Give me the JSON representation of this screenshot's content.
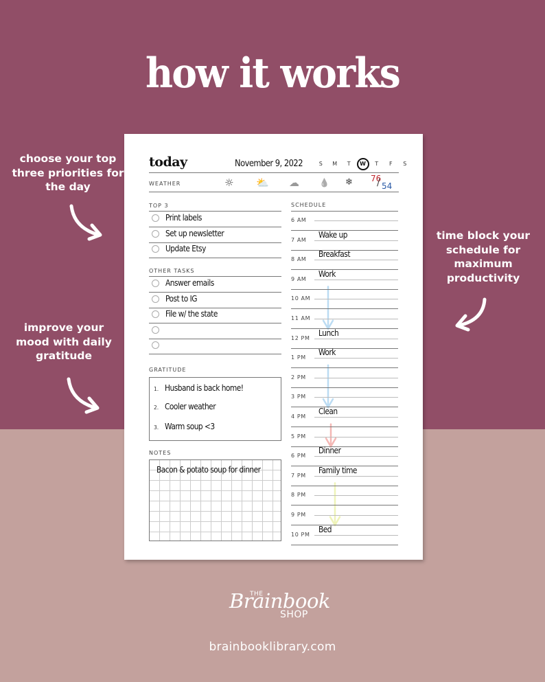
{
  "headline": "how it works",
  "callouts": [
    {
      "id": "priorities",
      "text": "choose your top three priorities for the day"
    },
    {
      "id": "gratitude",
      "text": "improve your mood with daily gratitude"
    },
    {
      "id": "timeblock",
      "text": "time block your schedule for maximum productivity"
    }
  ],
  "planner": {
    "title": "today",
    "date": "November 9, 2022",
    "weekdays": [
      "S",
      "M",
      "T",
      "W",
      "T",
      "F",
      "S"
    ],
    "selected_weekday_index": 3,
    "weather": {
      "label": "WEATHER",
      "icons": [
        {
          "name": "sun-icon",
          "glyph": "☼"
        },
        {
          "name": "partly-cloudy-icon",
          "glyph": "⛅"
        },
        {
          "name": "windy-cloud-icon",
          "glyph": "☁"
        },
        {
          "name": "rain-drop-icon",
          "glyph": "💧"
        },
        {
          "name": "snowflake-icon",
          "glyph": "❄"
        }
      ],
      "temp_high": "76",
      "temp_low": "54",
      "temp_separator": "/"
    },
    "top3": {
      "label": "TOP 3",
      "items": [
        "Print labels",
        "Set up newsletter",
        "Update Etsy"
      ]
    },
    "other_tasks": {
      "label": "OTHER TASKS",
      "items": [
        "Answer emails",
        "Post to IG",
        "File w/ the state",
        "",
        ""
      ]
    },
    "gratitude": {
      "label": "GRATITUDE",
      "items": [
        {
          "num": "1.",
          "text": "Husband is back home!"
        },
        {
          "num": "2.",
          "text": "Cooler weather"
        },
        {
          "num": "3.",
          "text": "Warm soup <3"
        }
      ]
    },
    "notes": {
      "label": "NOTES",
      "text": "Bacon & potato soup for dinner"
    },
    "schedule": {
      "label": "SCHEDULE",
      "rows": [
        {
          "time": "6 AM",
          "entry": ""
        },
        {
          "time": "7 AM",
          "entry": "Wake up"
        },
        {
          "time": "8 AM",
          "entry": "Breakfast"
        },
        {
          "time": "9 AM",
          "entry": "Work"
        },
        {
          "time": "10 AM",
          "entry": ""
        },
        {
          "time": "11 AM",
          "entry": ""
        },
        {
          "time": "12 PM",
          "entry": "Lunch"
        },
        {
          "time": "1 PM",
          "entry": "Work"
        },
        {
          "time": "2 PM",
          "entry": ""
        },
        {
          "time": "3 PM",
          "entry": ""
        },
        {
          "time": "4 PM",
          "entry": "Clean"
        },
        {
          "time": "5 PM",
          "entry": ""
        },
        {
          "time": "6 PM",
          "entry": "Dinner"
        },
        {
          "time": "7 PM",
          "entry": "Family time"
        },
        {
          "time": "8 PM",
          "entry": ""
        },
        {
          "time": "9 PM",
          "entry": ""
        },
        {
          "time": "10 PM",
          "entry": "Bed"
        }
      ],
      "blocks": [
        {
          "from": "9 AM",
          "to": "12 PM",
          "color": "#bcdcf3"
        },
        {
          "from": "1 PM",
          "to": "4 PM",
          "color": "#bcdcf3"
        },
        {
          "from": "4 PM",
          "to": "6 PM",
          "color": "#f4b8b5"
        },
        {
          "from": "7 PM",
          "to": "10 PM",
          "color": "#eef3b8"
        }
      ]
    }
  },
  "brand": {
    "the": "THE",
    "script": "Brainbook",
    "shop": "SHOP",
    "url": "brainbooklibrary.com"
  },
  "colors": {
    "plum": "#914e67",
    "dusty_rose": "#c3a19d",
    "temp_high": "#c0272d",
    "temp_low": "#2a5aa6"
  }
}
